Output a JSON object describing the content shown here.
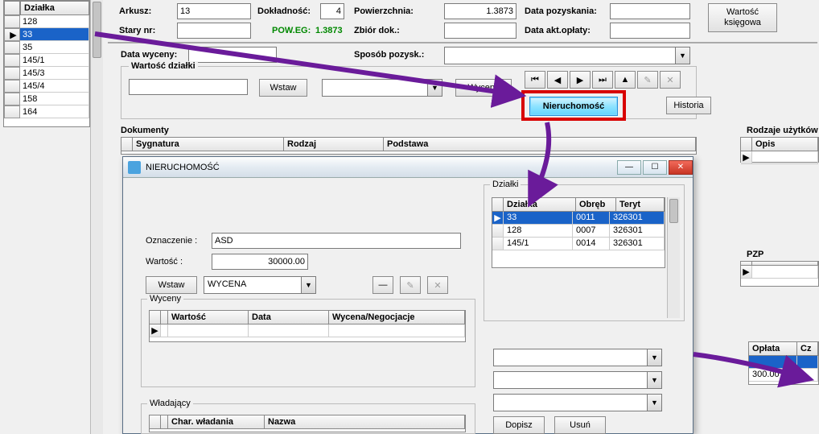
{
  "left_panel": {
    "header": "Działka",
    "rows": [
      "128",
      "33",
      "35",
      "145/1",
      "145/3",
      "145/4",
      "158",
      "164"
    ],
    "selected": "33"
  },
  "form": {
    "arkusz_label": "Arkusz:",
    "arkusz_value": "13",
    "dokladnosc_label": "Dokładność:",
    "dokladnosc_value": "4",
    "powierzchnia_label": "Powierzchnia:",
    "powierzchnia_value": "1.3873",
    "data_pozyskania_label": "Data pozyskania:",
    "wartosc_ksiegowa_btn": "Wartość księgowa",
    "stary_nr_label": "Stary nr:",
    "poweg_label": "POW.EG:",
    "poweg_value": "1.3873",
    "zbior_dok_label": "Zbiór dok.:",
    "data_akt_label": "Data akt.opłaty:",
    "data_wyceny_label": "Data wyceny:",
    "sposob_pozysk_label": "Sposób pozysk.:",
    "wartosc_dzialki_group": "Wartość działki",
    "wstaw_btn": "Wstaw",
    "wyceny_btn": "Wyceny",
    "nieruchomosc_btn": "Nieruchomość",
    "historia_btn": "Historia",
    "dokumenty_label": "Dokumenty",
    "dk_cols": {
      "sygnatura": "Sygnatura",
      "rodzaj": "Rodzaj",
      "podstawa": "Podstawa"
    }
  },
  "nav_icons": {
    "first": "⏮",
    "prev": "◀",
    "next": "▶",
    "last": "⏭",
    "up": "▲",
    "pencil": "✎",
    "x": "✕"
  },
  "right": {
    "rodzaje_uzytkow": "Rodzaje użytków",
    "opis": "Opis",
    "pzp": "PZP",
    "oplata": "Opłata",
    "c_other": "Cz",
    "oplata_value": "300.00"
  },
  "dialog": {
    "title": "NIERUCHOMOŚĆ",
    "dzialki_group": "Działki",
    "grid_cols": {
      "dzialka": "Działka",
      "obreb": "Obręb",
      "teryt": "Teryt"
    },
    "grid_rows": [
      {
        "dzialka": "33",
        "obreb": "0011",
        "teryt": "326301",
        "sel": true
      },
      {
        "dzialka": "128",
        "obreb": "0007",
        "teryt": "326301"
      },
      {
        "dzialka": "145/1",
        "obreb": "0014",
        "teryt": "326301"
      }
    ],
    "oznaczenie_label": "Oznaczenie :",
    "oznaczenie_value": "ASD",
    "wartosc_label": "Wartość :",
    "wartosc_value": "30000.00",
    "wstaw_btn": "Wstaw",
    "wycena_combo": "WYCENA",
    "minus": "—",
    "pencil": "✎",
    "x": "✕",
    "wyceny_group": "Wyceny",
    "wyceny_cols": {
      "wartosc": "Wartość",
      "data": "Data",
      "wn": "Wycena/Negocjacje"
    },
    "wladajacy_group": "Władający",
    "wlad_cols": {
      "char": "Char. władania",
      "nazwa": "Nazwa"
    },
    "dopisz_btn": "Dopisz",
    "usun_btn": "Usuń"
  }
}
